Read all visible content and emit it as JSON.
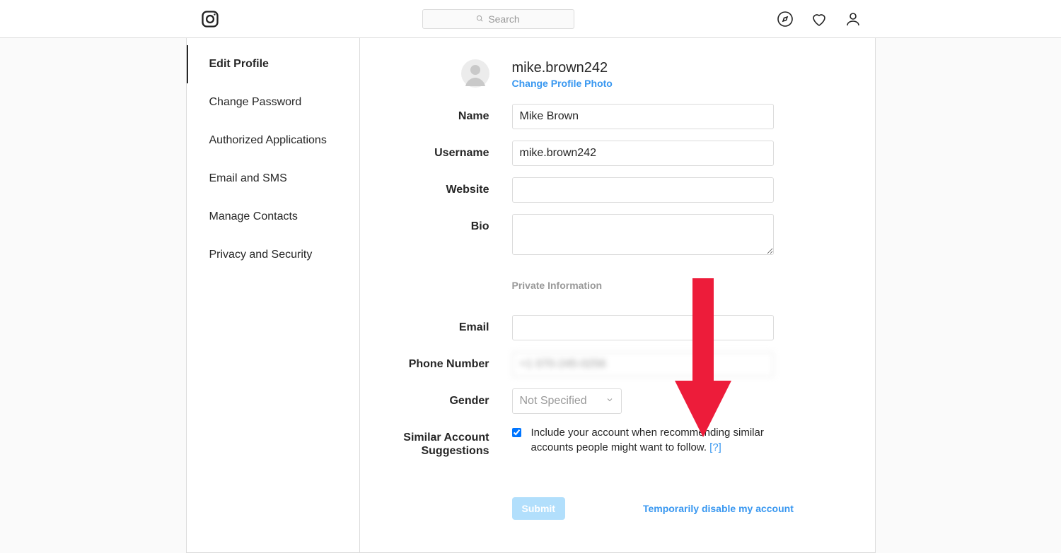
{
  "topbar": {
    "search_placeholder": "Search"
  },
  "sidebar": {
    "items": [
      {
        "label": "Edit Profile"
      },
      {
        "label": "Change Password"
      },
      {
        "label": "Authorized Applications"
      },
      {
        "label": "Email and SMS"
      },
      {
        "label": "Manage Contacts"
      },
      {
        "label": "Privacy and Security"
      }
    ]
  },
  "profile": {
    "username_display": "mike.brown242",
    "change_photo": "Change Profile Photo"
  },
  "form": {
    "labels": {
      "name": "Name",
      "username": "Username",
      "website": "Website",
      "bio": "Bio",
      "private_info": "Private Information",
      "email": "Email",
      "phone": "Phone Number",
      "gender": "Gender",
      "similar": "Similar Account Suggestions"
    },
    "values": {
      "name": "Mike Brown",
      "username": "mike.brown242",
      "website": "",
      "bio": "",
      "email": "",
      "phone": "+1 070-245-0256",
      "gender": "Not Specified"
    },
    "similar_text": "Include your account when recommending similar accounts people might want to follow.",
    "similar_help": "[?]",
    "submit": "Submit",
    "disable": "Temporarily disable my account"
  }
}
